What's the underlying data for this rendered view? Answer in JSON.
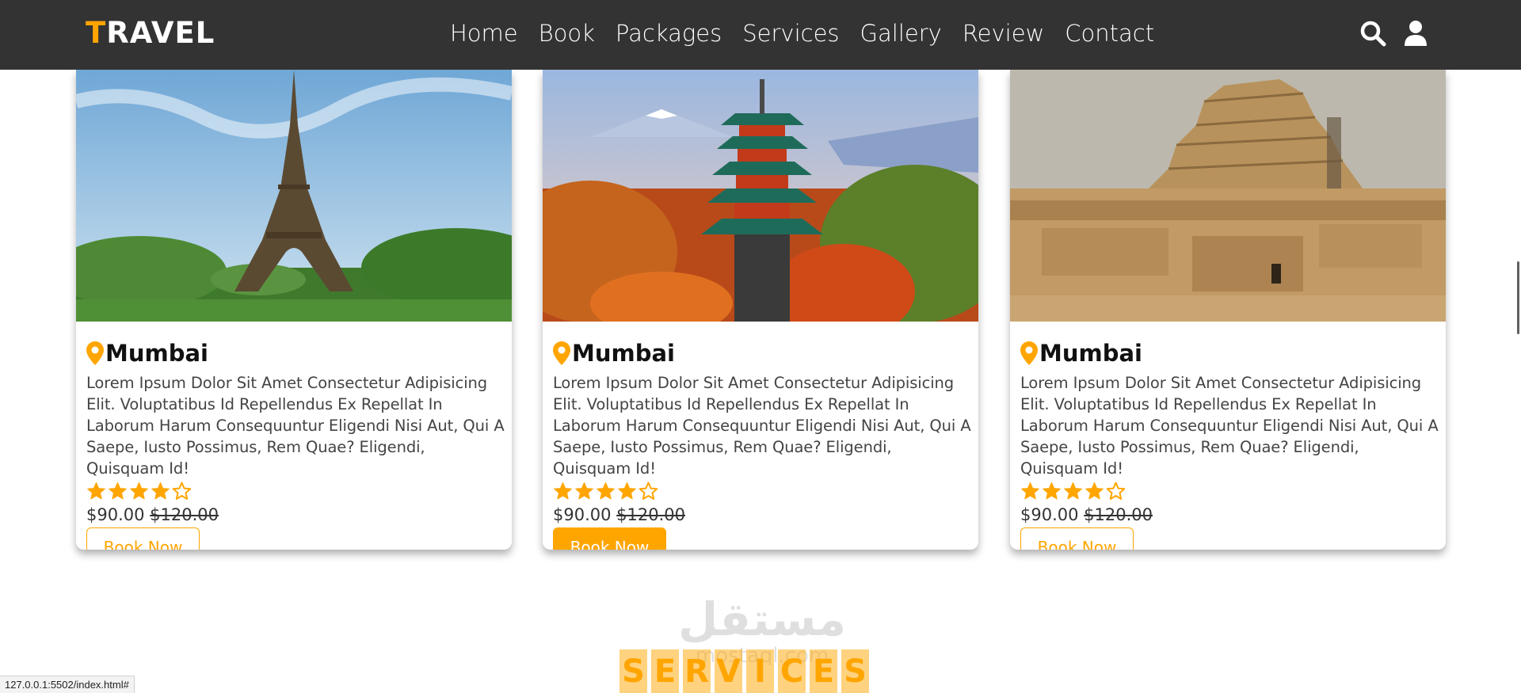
{
  "navbar": {
    "logo_first": "T",
    "logo_rest": "RAVEL",
    "links": [
      "Home",
      "Book",
      "Packages",
      "Services",
      "Gallery",
      "Review",
      "Contact"
    ],
    "icons": [
      "search-icon",
      "user-icon"
    ]
  },
  "cards": [
    {
      "title": "Mumbai",
      "description": "Lorem Ipsum Dolor Sit Amet Consectetur Adipisicing Elit. Voluptatibus Id Repellendus Ex Repellat In Laborum Harum Consequuntur Eligendi Nisi Aut, Qui A Saepe, Iusto Possimus, Rem Quae? Eligendi, Quisquam Id!",
      "rating": 4,
      "rating_max": 5,
      "price": "$90.00",
      "old_price": "$120.00",
      "button": "Book Now",
      "button_active": false,
      "image": "eiffel-tower"
    },
    {
      "title": "Mumbai",
      "description": "Lorem Ipsum Dolor Sit Amet Consectetur Adipisicing Elit. Voluptatibus Id Repellendus Ex Repellat In Laborum Harum Consequuntur Eligendi Nisi Aut, Qui A Saepe, Iusto Possimus, Rem Quae? Eligendi, Quisquam Id!",
      "rating": 4,
      "rating_max": 5,
      "price": "$90.00",
      "old_price": "$120.00",
      "button": "Book Now",
      "button_active": true,
      "image": "japanese-pagoda"
    },
    {
      "title": "Mumbai",
      "description": "Lorem Ipsum Dolor Sit Amet Consectetur Adipisicing Elit. Voluptatibus Id Repellendus Ex Repellat In Laborum Harum Consequuntur Eligendi Nisi Aut, Qui A Saepe, Iusto Possimus, Rem Quae? Eligendi, Quisquam Id!",
      "rating": 4,
      "rating_max": 5,
      "price": "$90.00",
      "old_price": "$120.00",
      "button": "Book Now",
      "button_active": false,
      "image": "step-pyramid"
    }
  ],
  "services_heading": [
    "S",
    "E",
    "R",
    "V",
    "I",
    "C",
    "E",
    "S"
  ],
  "watermark": {
    "arabic": "مستقل",
    "latin": "mostaql.com"
  },
  "status_bar": {
    "url": "127.0.0.1:5502/index.html#"
  },
  "colors": {
    "accent": "#ffa500",
    "navbar_bg": "#333333"
  }
}
